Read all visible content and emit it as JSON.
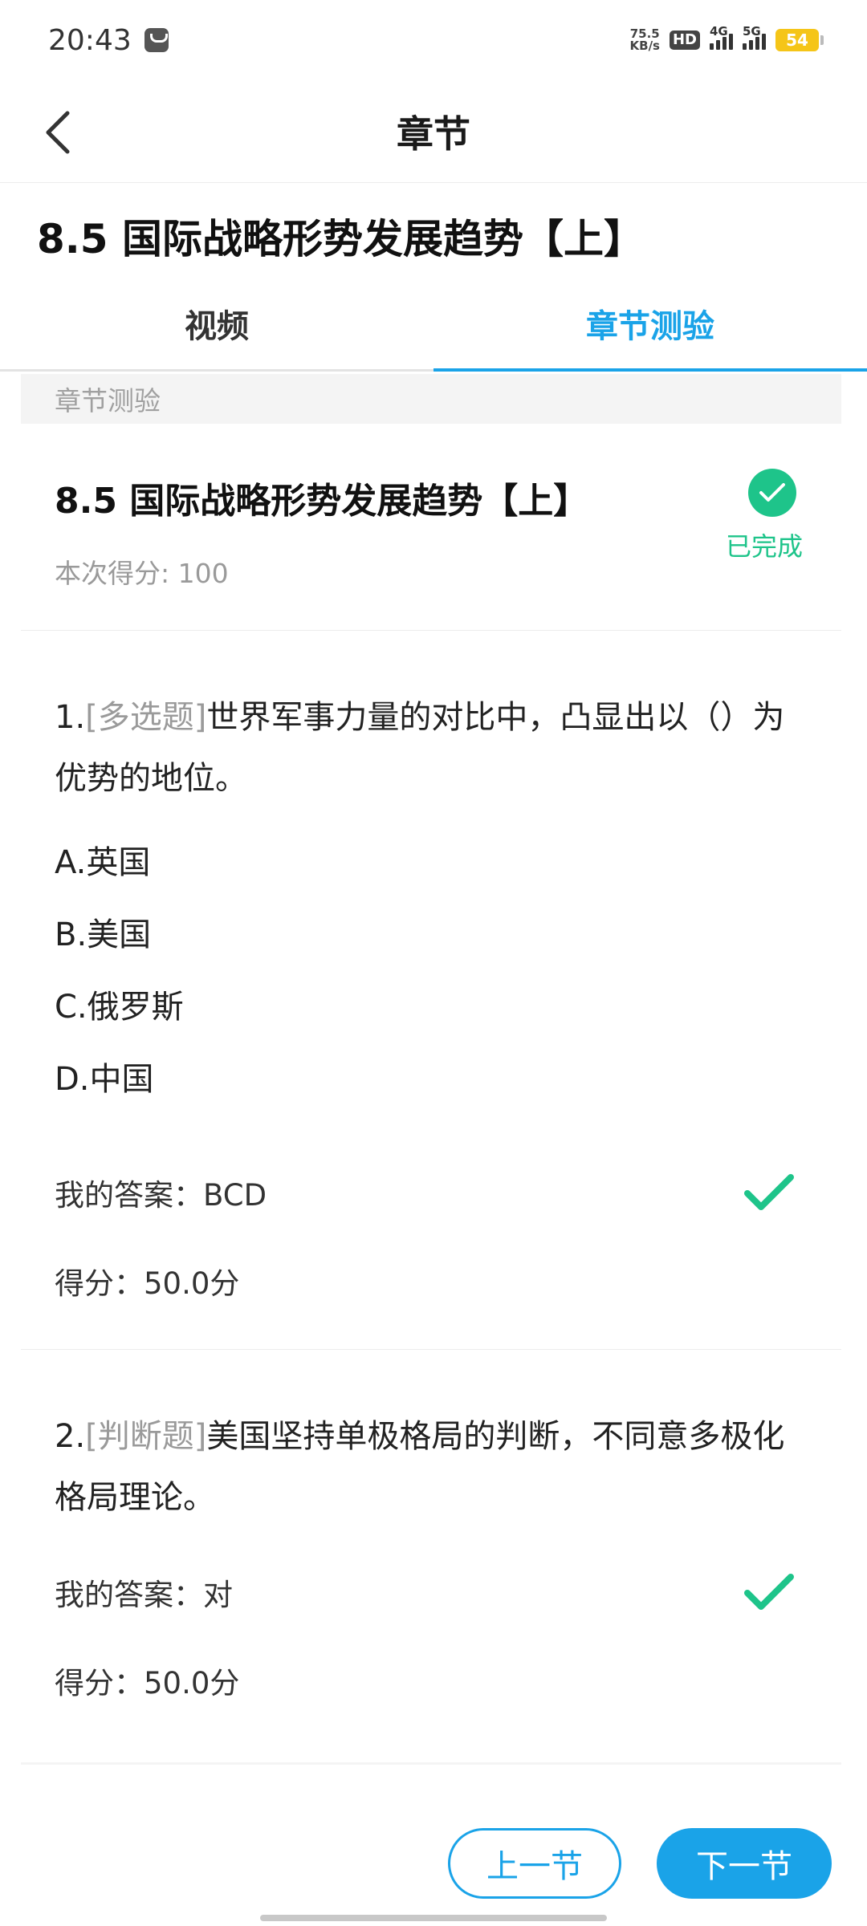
{
  "status_bar": {
    "time": "20:43",
    "net_speed_value": "75.5",
    "net_speed_unit": "KB/s",
    "hd_label": "HD",
    "signal1_label": "4G",
    "signal2_label": "5G",
    "battery": "54"
  },
  "nav": {
    "title": "章节"
  },
  "chapter": {
    "title": "8.5 国际战略形势发展趋势【上】"
  },
  "tabs": [
    {
      "label": "视频",
      "active": false
    },
    {
      "label": "章节测验",
      "active": true
    }
  ],
  "quiz": {
    "section_label": "章节测验",
    "title": "8.5 国际战略形势发展趋势【上】",
    "score_text": "本次得分: 100",
    "status_label": "已完成",
    "questions": [
      {
        "number": "1.",
        "type": "[多选题]",
        "text": "世界军事力量的对比中，凸显出以（）为优势的地位。",
        "options": [
          "A.英国",
          "B.美国",
          "C.俄罗斯",
          "D.中国"
        ],
        "my_answer": "我的答案：BCD",
        "score": "得分：50.0分"
      },
      {
        "number": "2.",
        "type": "[判断题]",
        "text": "美国坚持单极格局的判断，不同意多极化格局理论。",
        "my_answer": "我的答案：对",
        "score": "得分：50.0分"
      }
    ]
  },
  "buttons": {
    "prev": "上一节",
    "next": "下一节"
  },
  "colors": {
    "accent": "#1aa3e8",
    "success": "#1ec48a",
    "muted": "#9a9a9a"
  }
}
